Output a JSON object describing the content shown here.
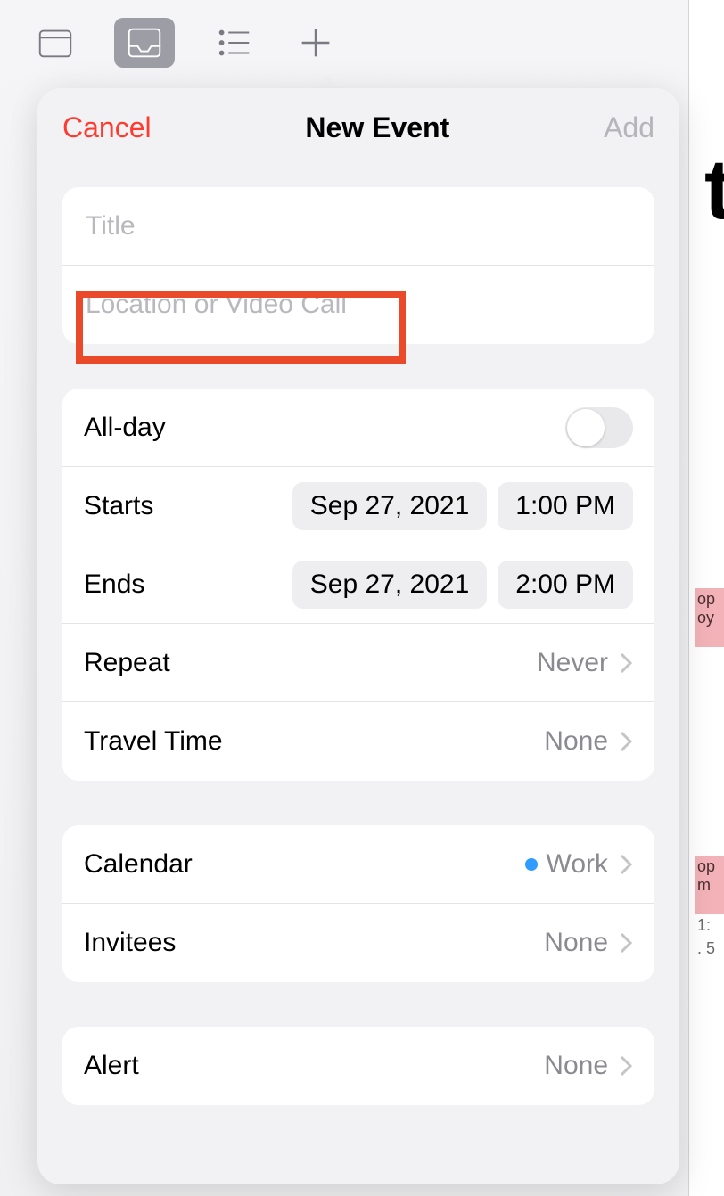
{
  "toolbar": {
    "icons": [
      "calendar-icon",
      "inbox-icon",
      "list-icon",
      "plus-icon"
    ]
  },
  "background": {
    "big_letter": "t",
    "block1_line1": "op",
    "block1_line2": "oy",
    "block2_line1": "op",
    "block2_line2": "m",
    "sub_a": "1:",
    "sub_b": ". 5"
  },
  "popover": {
    "cancel": "Cancel",
    "title": "New Event",
    "add": "Add",
    "title_placeholder": "Title",
    "location_placeholder": "Location or Video Call",
    "allday_label": "All-day",
    "allday_on": false,
    "starts_label": "Starts",
    "starts_date": "Sep 27, 2021",
    "starts_time": "1:00 PM",
    "ends_label": "Ends",
    "ends_date": "Sep 27, 2021",
    "ends_time": "2:00 PM",
    "repeat_label": "Repeat",
    "repeat_value": "Never",
    "travel_label": "Travel Time",
    "travel_value": "None",
    "calendar_label": "Calendar",
    "calendar_value": "Work",
    "calendar_dot_color": "#2f9cff",
    "invitees_label": "Invitees",
    "invitees_value": "None",
    "alert_label": "Alert",
    "alert_value": "None"
  }
}
